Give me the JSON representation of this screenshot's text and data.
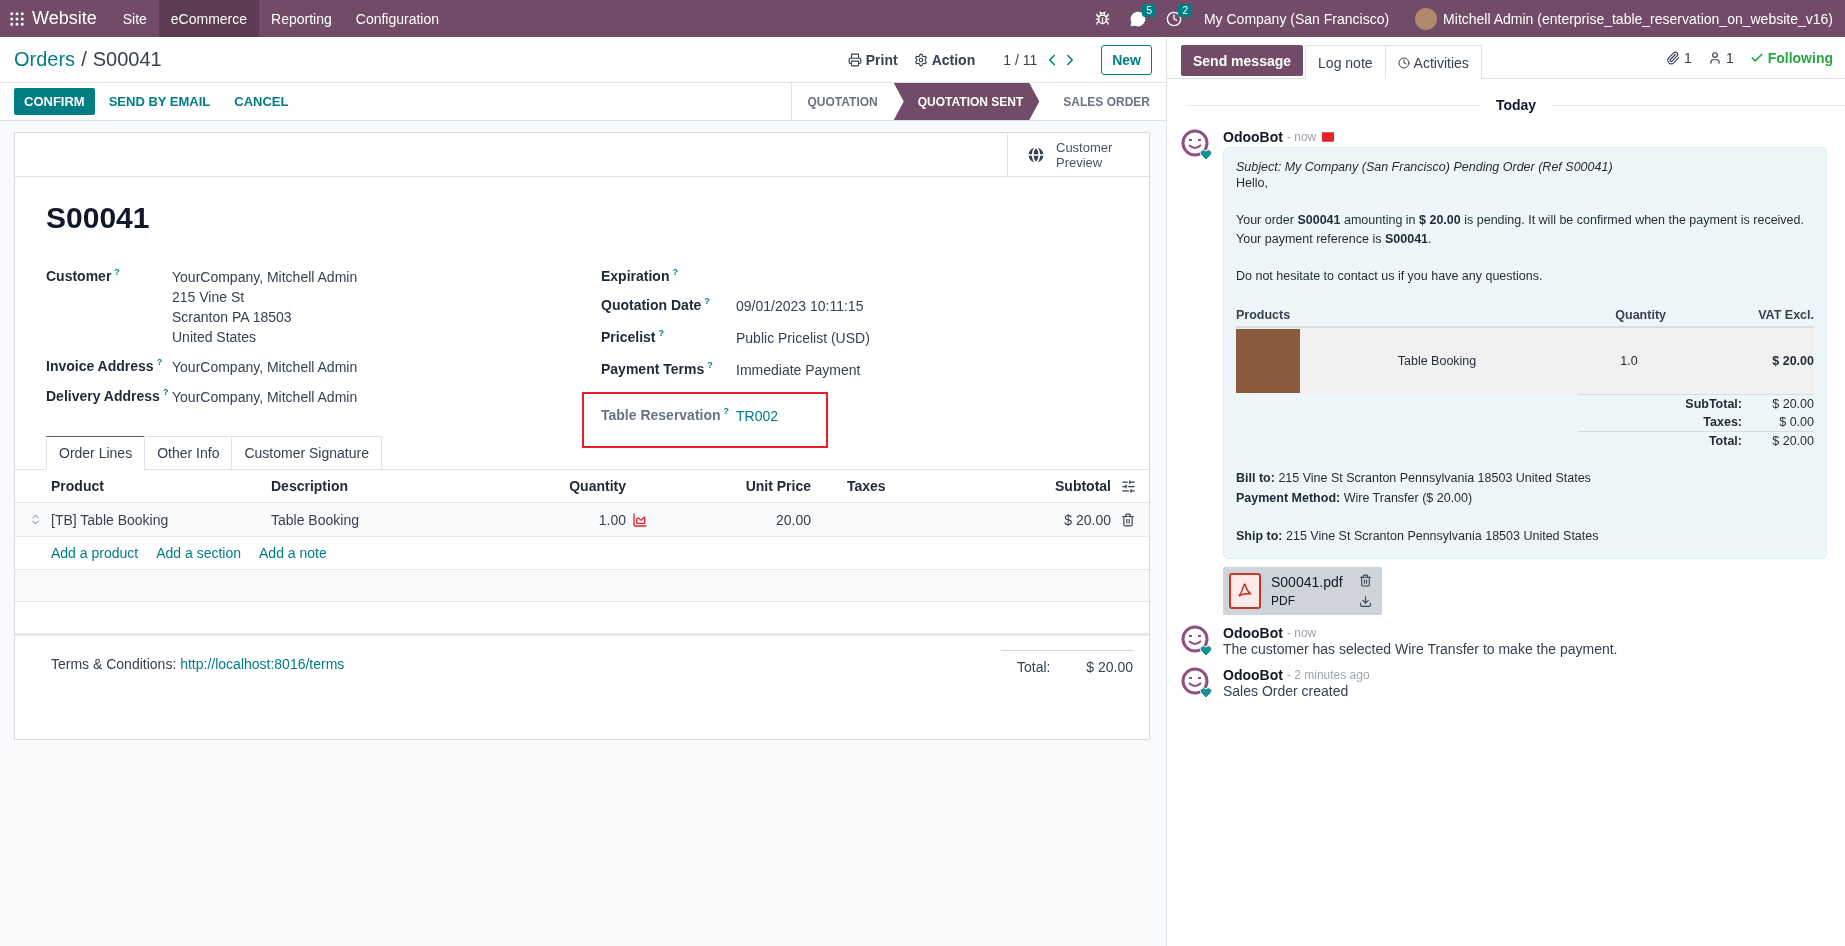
{
  "navbar": {
    "brand": "Website",
    "menu": [
      {
        "label": "Site",
        "selected": false
      },
      {
        "label": "eCommerce",
        "selected": true
      },
      {
        "label": "Reporting",
        "selected": false
      },
      {
        "label": "Configuration",
        "selected": false
      }
    ],
    "messages_badge": "5",
    "activities_badge": "2",
    "company": "My Company (San Francisco)",
    "user": "Mitchell Admin (enterprise_table_reservation_on_website_v16)"
  },
  "control_panel": {
    "breadcrumb": [
      "Orders",
      "S00041"
    ],
    "breadcrumb_separator": "/",
    "actions": [
      "Print",
      "Action"
    ],
    "pager": "1 / 11",
    "new_button": "New"
  },
  "action_buttons": [
    {
      "label": "CONFIRM",
      "kind": "primary"
    },
    {
      "label": "SEND BY EMAIL",
      "kind": "link"
    },
    {
      "label": "CANCEL",
      "kind": "link"
    }
  ],
  "status_stages": [
    {
      "label": "QUOTATION",
      "selected": false
    },
    {
      "label": "QUOTATION SENT",
      "selected": true
    },
    {
      "label": "SALES ORDER",
      "selected": false
    }
  ],
  "sheet": {
    "smart_button": [
      "Customer",
      "Preview"
    ],
    "title": "S00041",
    "left_fields": [
      {
        "label": "Customer",
        "help": "?",
        "muted": false,
        "highlighted": false,
        "kind": "text",
        "lines": [
          "YourCompany, Mitchell Admin",
          "215 Vine St",
          "Scranton PA 18503",
          "United States"
        ]
      },
      {
        "label": "Invoice Address",
        "help": "?",
        "muted": false,
        "highlighted": false,
        "kind": "text",
        "lines": [
          "YourCompany, Mitchell Admin"
        ]
      },
      {
        "label": "Delivery Address",
        "help": "?",
        "muted": false,
        "highlighted": false,
        "kind": "text",
        "lines": [
          "YourCompany, Mitchell Admin"
        ]
      }
    ],
    "right_fields": [
      {
        "label": "Expiration",
        "help": "?",
        "muted": false,
        "highlighted": false
      },
      {
        "label": "Quotation Date",
        "help": "?",
        "muted": false,
        "highlighted": false,
        "kind": "text",
        "lines": [
          "09/01/2023 10:11:15"
        ]
      },
      {
        "label": "Pricelist",
        "help": "?",
        "muted": false,
        "highlighted": false,
        "kind": "text",
        "lines": [
          "Public Pricelist (USD)"
        ]
      },
      {
        "label": "Payment Terms",
        "help": "?",
        "muted": false,
        "highlighted": false,
        "kind": "text",
        "lines": [
          "Immediate Payment"
        ]
      },
      {
        "label": "Table Reservation",
        "help": "?",
        "muted": true,
        "highlighted": true,
        "kind": "link",
        "lines": [
          "TR002"
        ]
      }
    ],
    "tabs": [
      {
        "label": "Order Lines",
        "selected": true
      },
      {
        "label": "Other Info",
        "selected": false
      },
      {
        "label": "Customer Signature",
        "selected": false
      }
    ],
    "table": {
      "columns": [
        "Product",
        "Description",
        "Quantity",
        "Unit Price",
        "Taxes",
        "Subtotal"
      ],
      "rows": [
        {
          "product": "[TB] Table Booking",
          "description": "Table Booking",
          "quantity": "1.00",
          "unit_price": "20.00",
          "subtotal": "$ 20.00"
        }
      ],
      "add_links": [
        "Add a product",
        "Add a section",
        "Add a note"
      ]
    },
    "terms_label": "Terms & Conditions:",
    "terms_link": "http://localhost:8016/terms",
    "total_label": "Total:",
    "total_value": "$ 20.00"
  },
  "chatter": {
    "buttons": [
      {
        "label": "Send message",
        "selected": true,
        "kind": "plain"
      },
      {
        "label": "Log note",
        "selected": false,
        "kind": "plain"
      },
      {
        "label": "Activities",
        "selected": false,
        "kind": "clock"
      }
    ],
    "attachments_count": "1",
    "followers_count": "1",
    "follow_label": "Following",
    "date_separator": "Today",
    "messages": [
      {
        "author": "OdooBot",
        "time": "- now",
        "kind": "email",
        "subject": "Subject: My Company (San Francisco) Pending Order (Ref S00041)",
        "paragraphs": [
          [
            "Hello,"
          ],
          [
            "Your order **S00041** amounting in **$ 20.00** is pending. It will be confirmed when the payment is received.",
            "Your payment reference is **S00041**."
          ],
          [
            "Do not hesitate to contact us if you have any questions."
          ]
        ],
        "table": {
          "columns": [
            "Products",
            "Quantity",
            "VAT Excl."
          ],
          "rows": [
            {
              "product": "Table Booking",
              "quantity": "1.0",
              "price": "$ 20.00"
            }
          ],
          "totals": [
            {
              "label": "SubTotal:",
              "value": "$ 20.00"
            },
            {
              "label": "Taxes:",
              "value": "$ 0.00"
            },
            {
              "label": "Total:",
              "value": "$ 20.00"
            }
          ]
        },
        "detail_groups": [
          [
            {
              "label": "Bill to:",
              "value": "215 Vine St Scranton Pennsylvania 18503 United States"
            },
            {
              "label": "Payment Method:",
              "value": "Wire Transfer ($ 20.00)"
            }
          ],
          [
            {
              "label": "Ship to:",
              "value": "215 Vine St Scranton Pennsylvania 18503 United States"
            }
          ]
        ],
        "attachment": {
          "name": "S00041.pdf",
          "type": "PDF"
        }
      },
      {
        "author": "OdooBot",
        "time": "- now",
        "kind": "note",
        "text": "The customer has selected Wire Transfer to make the payment."
      },
      {
        "author": "OdooBot",
        "time": "- 2 minutes ago",
        "kind": "note",
        "text": "Sales Order created"
      }
    ]
  }
}
